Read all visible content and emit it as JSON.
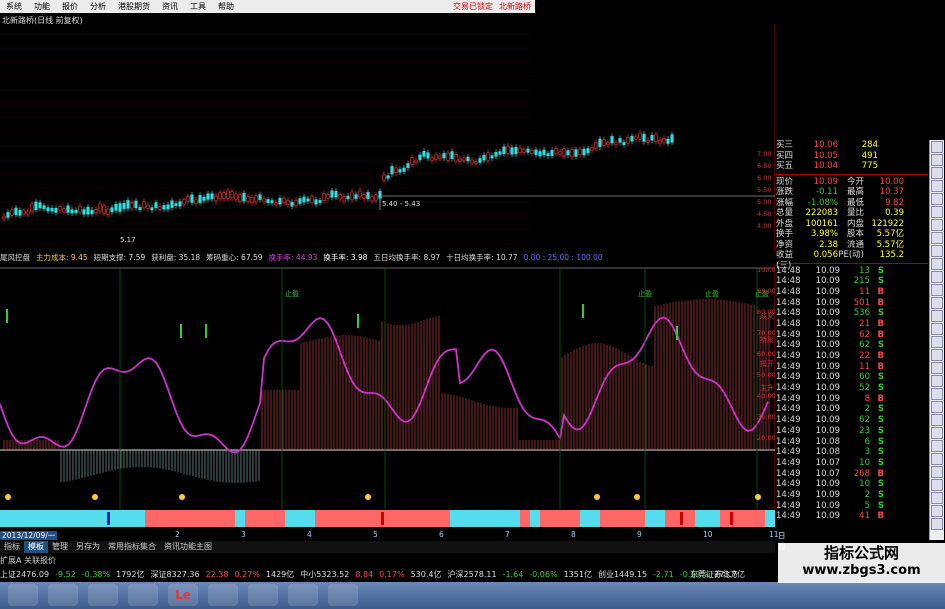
{
  "menu": {
    "items": [
      "系统",
      "功能",
      "报价",
      "分析",
      "港股期货",
      "资讯",
      "工具",
      "帮助"
    ],
    "right": [
      "交易已锁定",
      "北新路桥"
    ]
  },
  "chart_title": "北新路桥(日线 前复权)",
  "main": {
    "range_label": "5.40 - 5.43",
    "low_label": "5.17",
    "yaxis": [
      "7.00",
      "6.50",
      "6.00",
      "5.50",
      "5.00",
      "4.50",
      "4.00"
    ]
  },
  "indicator_strip": [
    {
      "t": "尾风控盘",
      "c": "#ddd"
    },
    {
      "t": "主力成本: 9.45",
      "c": "#fc4"
    },
    {
      "t": "短期支撑: 7.59",
      "c": "#ddd"
    },
    {
      "t": "获利盘: 35.18",
      "c": "#ddd"
    },
    {
      "t": "筹码重心: 67.59",
      "c": "#ddd"
    },
    {
      "t": "换手率: 44.93",
      "c": "#c4c"
    },
    {
      "t": "换手率: 3.98",
      "c": "#fff"
    },
    {
      "t": "五日均换手率: 8.97",
      "c": "#ddd"
    },
    {
      "t": "十日均换手率: 10.77",
      "c": "#ddd"
    },
    {
      "t": "0.00 : 25.00 : 100.00",
      "c": "#66f"
    }
  ],
  "sub": {
    "labels": [
      "止盈",
      "止盈",
      "止盈",
      "止盈"
    ],
    "yaxis": [
      "100.00",
      "90.00",
      "80.00",
      "70.00",
      "60.00",
      "50.00",
      "40.00",
      "30.00",
      "20.00"
    ],
    "right_tags": [
      "成交",
      "持股",
      "揭开",
      "主升"
    ]
  },
  "datebar": "2013/12/09/一",
  "date_ticks": [
    "2",
    "3",
    "4",
    "5",
    "6",
    "7",
    "8",
    "9",
    "10",
    "11"
  ],
  "date_end": "日线",
  "bottom_tabs": [
    "指标",
    "模板",
    "管理",
    "另存为",
    "常用指标集合",
    "资讯功能主图"
  ],
  "bottom_extra": "扩展A 关联报价",
  "quote": {
    "orders": [
      {
        "k": "买三",
        "p": "10.06",
        "v": "284"
      },
      {
        "k": "买四",
        "p": "10.05",
        "v": "491"
      },
      {
        "k": "买五",
        "p": "10.04",
        "v": "775"
      }
    ],
    "stats": [
      {
        "k": "现价",
        "v": "10.09",
        "k2": "今开",
        "v2": "10.00"
      },
      {
        "k": "涨跌",
        "v": "-0.11",
        "k2": "最高",
        "v2": "10.37"
      },
      {
        "k": "涨幅",
        "v": "-1.08%",
        "k2": "最低",
        "v2": "9.82"
      },
      {
        "k": "总量",
        "v": "222083",
        "k2": "量比",
        "v2": "0.39"
      },
      {
        "k": "外盘",
        "v": "100161",
        "k2": "内盘",
        "v2": "121922"
      },
      {
        "k": "换手",
        "v": "3.98%",
        "k2": "股本",
        "v2": "5.57亿"
      },
      {
        "k": "净资",
        "v": "2.38",
        "k2": "流通",
        "v2": "5.57亿"
      },
      {
        "k": "收益(三)",
        "v": "0.056",
        "k2": "PE(动)",
        "v2": "135.2"
      }
    ],
    "ticks": [
      {
        "t": "14:48",
        "p": "10.09",
        "v": "13",
        "s": "S"
      },
      {
        "t": "14:48",
        "p": "10.09",
        "v": "215",
        "s": "S"
      },
      {
        "t": "14:48",
        "p": "10.09",
        "v": "11",
        "s": "B"
      },
      {
        "t": "14:48",
        "p": "10.09",
        "v": "501",
        "s": "B"
      },
      {
        "t": "14:48",
        "p": "10.09",
        "v": "536",
        "s": "S"
      },
      {
        "t": "14:48",
        "p": "10.09",
        "v": "21",
        "s": "B"
      },
      {
        "t": "14:49",
        "p": "10.09",
        "v": "62",
        "s": "B"
      },
      {
        "t": "14:49",
        "p": "10.09",
        "v": "62",
        "s": "S"
      },
      {
        "t": "14:49",
        "p": "10.09",
        "v": "22",
        "s": "B"
      },
      {
        "t": "14:49",
        "p": "10.09",
        "v": "11",
        "s": "B"
      },
      {
        "t": "14:49",
        "p": "10.09",
        "v": "60",
        "s": "S"
      },
      {
        "t": "14:49",
        "p": "10.09",
        "v": "52",
        "s": "S"
      },
      {
        "t": "14:49",
        "p": "10.09",
        "v": "8",
        "s": "B"
      },
      {
        "t": "14:49",
        "p": "10.09",
        "v": "2",
        "s": "S"
      },
      {
        "t": "14:49",
        "p": "10.09",
        "v": "62",
        "s": "S"
      },
      {
        "t": "14:49",
        "p": "10.09",
        "v": "23",
        "s": "S"
      },
      {
        "t": "14:49",
        "p": "10.08",
        "v": "6",
        "s": "S"
      },
      {
        "t": "14:49",
        "p": "10.08",
        "v": "3",
        "s": "S"
      },
      {
        "t": "14:49",
        "p": "10.07",
        "v": "10",
        "s": "S"
      },
      {
        "t": "14:49",
        "p": "10.07",
        "v": "268",
        "s": "B"
      },
      {
        "t": "14:49",
        "p": "10.09",
        "v": "10",
        "s": "S"
      },
      {
        "t": "14:49",
        "p": "10.09",
        "v": "2",
        "s": "S"
      },
      {
        "t": "14:49",
        "p": "10.09",
        "v": "5",
        "s": "S"
      },
      {
        "t": "14:49",
        "p": "10.09",
        "v": "41",
        "s": "B"
      }
    ]
  },
  "ticker": [
    {
      "t": "上证2476.09",
      "c": "#ddd"
    },
    {
      "t": "-9.52",
      "c": "#3c3"
    },
    {
      "t": "-0.38%",
      "c": "#3c3"
    },
    {
      "t": "1792亿",
      "c": "#ddd"
    },
    {
      "t": "深证8327.36",
      "c": "#ddd"
    },
    {
      "t": "22.38",
      "c": "#f44"
    },
    {
      "t": "0.27%",
      "c": "#f44"
    },
    {
      "t": "1429亿",
      "c": "#ddd"
    },
    {
      "t": "中小5323.52",
      "c": "#ddd"
    },
    {
      "t": "8.84",
      "c": "#f44"
    },
    {
      "t": "0.17%",
      "c": "#f44"
    },
    {
      "t": "530.4亿",
      "c": "#ddd"
    },
    {
      "t": "沪深2578.11",
      "c": "#ddd"
    },
    {
      "t": "-1.64",
      "c": "#3c3"
    },
    {
      "t": "-0.06%",
      "c": "#3c3"
    },
    {
      "t": "1351亿",
      "c": "#ddd"
    },
    {
      "t": "创业1449.15",
      "c": "#ddd"
    },
    {
      "t": "-2.71",
      "c": "#3c3"
    },
    {
      "t": "-0.19%",
      "c": "#3c3"
    },
    {
      "t": "273.7亿",
      "c": "#ddd"
    }
  ],
  "ticker_right": "东莞证券北方",
  "watermark": {
    "line1": "指标公式网",
    "line2": "www.zbgs3.com"
  },
  "taskbar_icons": [
    "start-orb-icon",
    "ie-icon",
    "folder-icon",
    "media-icon",
    "le-icon",
    "app-icon",
    "app2-icon",
    "app3-icon",
    "app4-icon"
  ]
}
